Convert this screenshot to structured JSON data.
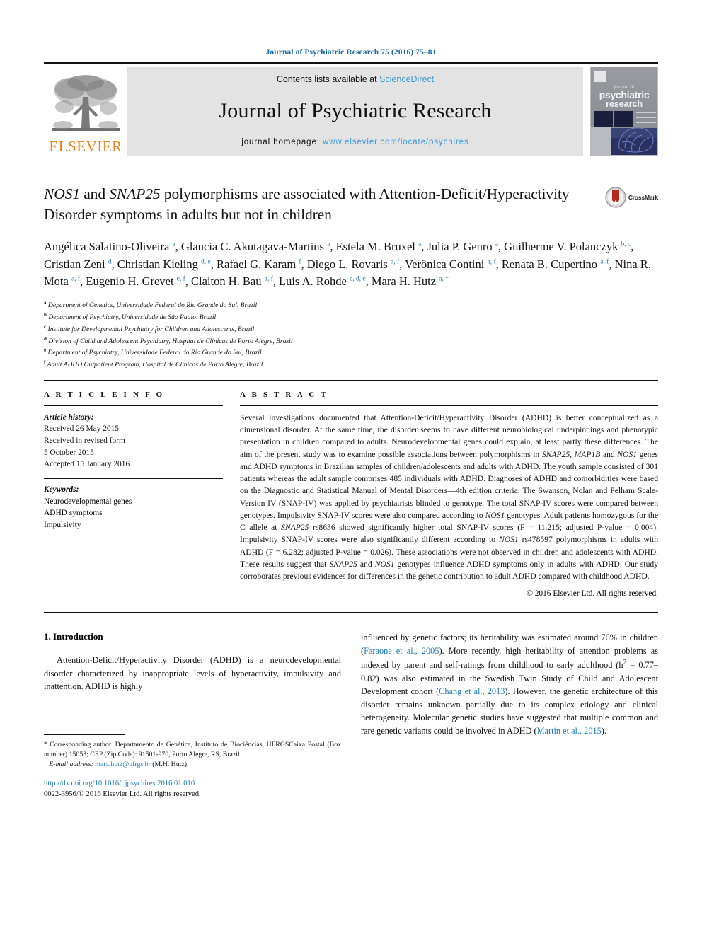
{
  "running_head": "Journal of Psychiatric Research 75 (2016) 75–81",
  "banner": {
    "contents_prefix": "Contents lists available at ",
    "contents_link": "ScienceDirect",
    "journal_title": "Journal of Psychiatric Research",
    "homepage_prefix": "journal homepage: ",
    "homepage_link": "www.elsevier.com/locate/psychires",
    "publisher_wordmark": "ELSEVIER",
    "cover": {
      "line_small": "journal of",
      "line1": "psychiatric",
      "line2": "research"
    }
  },
  "article": {
    "title_part1": "NOS1",
    "title_part2": " and ",
    "title_part3": "SNAP25",
    "title_part4": " polymorphisms are associated with Attention-Deficit/Hyperactivity Disorder symptoms in adults but not in children",
    "crossmark_label": "CrossMark",
    "authors_html": "Angélica Salatino-Oliveira <sup>a</sup>, Glaucia C. Akutagava-Martins <sup>a</sup>, Estela M. Bruxel <sup>a</sup>, Julia P. Genro <sup>a</sup>, Guilherme V. Polanczyk <sup>b, c</sup>, Cristian Zeni <sup>d</sup>, Christian Kieling <sup>d, e</sup>, Rafael G. Karam <sup>f</sup>, Diego L. Rovaris <sup>a, f</sup>, Verônica Contini <sup>a, f</sup>, Renata B. Cupertino <sup>a, f</sup>, Nina R. Mota <sup>a, f</sup>, Eugenio H. Grevet <sup>e, f</sup>, Claiton H. Bau <sup>a, f</sup>, Luis A. Rohde <sup>c, d, e</sup>, Mara H. Hutz <sup>a, *</sup>",
    "affiliations": [
      {
        "mark": "a",
        "text": "Department of Genetics, Universidade Federal do Rio Grande do Sul, Brazil"
      },
      {
        "mark": "b",
        "text": "Department of Psychiatry, Universidade de São Paulo, Brazil"
      },
      {
        "mark": "c",
        "text": "Institute for Developmental Psychiatry for Children and Adolescents, Brazil"
      },
      {
        "mark": "d",
        "text": "Division of Child and Adolescent Psychiatry, Hospital de Clínicas de Porto Alegre, Brazil"
      },
      {
        "mark": "e",
        "text": "Department of Psychiatry, Universidade Federal do Rio Grande do Sul, Brazil"
      },
      {
        "mark": "f",
        "text": "Adult ADHD Outpatient Program, Hospital de Clínicas de Porto Alegre, Brazil"
      }
    ]
  },
  "article_info": {
    "heading": "A R T I C L E  I N F O",
    "history_label": "Article history:",
    "history_lines": [
      "Received 26 May 2015",
      "Received in revised form",
      "5 October 2015",
      "Accepted 15 January 2016"
    ],
    "keywords_label": "Keywords:",
    "keywords": [
      "Neurodevelopmental genes",
      "ADHD symptoms",
      "Impulsivity"
    ]
  },
  "abstract": {
    "heading": "A B S T R A C T",
    "html": "Several investigations documented that Attention-Deficit/Hyperactivity Disorder (ADHD) is better conceptualized as a dimensional disorder. At the same time, the disorder seems to have different neurobiological underpinnings and phenotypic presentation in children compared to adults. Neurodevelopmental genes could explain, at least partly these differences. The aim of the present study was to examine possible associations between polymorphisms in <i>SNAP25</i>, <i>MAP1B</i> and <i>NOS1</i> genes and ADHD symptoms in Brazilian samples of children/adolescents and adults with ADHD. The youth sample consisted of 301 patients whereas the adult sample comprises 485 individuals with ADHD. Diagnoses of ADHD and comorbidities were based on the Diagnostic and Statistical Manual of Mental Disorders&#8212;4th edition criteria. The Swanson, Nolan and Pelham Scale-Version IV (SNAP-IV) was applied by psychiatrists blinded to genotype. The total SNAP-IV scores were compared between genotypes. Impulsivity SNAP-IV scores were also compared according to <i>NOS1</i> genotypes. Adult patients homozygous for the C allele at <i>SNAP25</i> rs8636 showed significantly higher total SNAP-IV scores (F = 11.215; adjusted P-value = 0.004). Impulsivity SNAP-IV scores were also significantly different according to <i>NOS1</i> rs478597 polymorphisms in adults with ADHD (F = 6.282; adjusted P-value = 0.026). These associations were not observed in children and adolescents with ADHD. These results suggest that <i>SNAP25</i> and <i>NOS1</i> genotypes influence ADHD symptoms only in adults with ADHD. Our study corroborates previous evidences for differences in the genetic contribution to adult ADHD compared with childhood ADHD.",
    "copyright": "© 2016 Elsevier Ltd. All rights reserved."
  },
  "body": {
    "section_heading": "1. Introduction",
    "left_paragraph": "Attention-Deficit/Hyperactivity Disorder (ADHD) is a neurodevelopmental disorder characterized by inappropriate levels of hyperactivity, impulsivity and inattention. ADHD is highly",
    "right_paragraph_html": "influenced by genetic factors; its heritability was estimated around 76% in children (<span class=\"cite\">Faraone et al., 2005</span>). More recently, high heritability of attention problems as indexed by parent and self-ratings from childhood to early adulthood (h<sup>2</sup> = 0.77&#8211;0.82) was also estimated in the Swedish Twin Study of Child and Adolescent Development cohort (<span class=\"cite\">Chang et al., 2013</span>). However, the genetic architecture of this disorder remains unknown partially due to its complex etiology and clinical heterogeneity. Molecular genetic studies have suggested that multiple common and rare genetic variants could be involved in ADHD (<span class=\"cite\">Martin et al., 2015</span>)."
  },
  "footnote": {
    "corresponding_html": "<span class=\"star\">*</span> Corresponding author. Departamento de Genética, Instituto de Biociências, UFRGSCaixa Postal (Box number) 15053; CEP (Zip Code): 91501-970, Porto Alegre, RS, Brazil.",
    "email_label": "E-mail address:",
    "email": "mara.hutz@ufrgs.br",
    "email_owner": "(M.H. Hutz).",
    "doi_url": "http://dx.doi.org/10.1016/j.jpsychires.2016.01.010",
    "issn_line": "0022-3956/© 2016 Elsevier Ltd. All rights reserved."
  },
  "colors": {
    "link_blue": "#1f7bbd",
    "elsevier_orange": "#f07f1a",
    "banner_grey": "#e3e3e3",
    "running_head_blue": "#1a6aa8"
  }
}
